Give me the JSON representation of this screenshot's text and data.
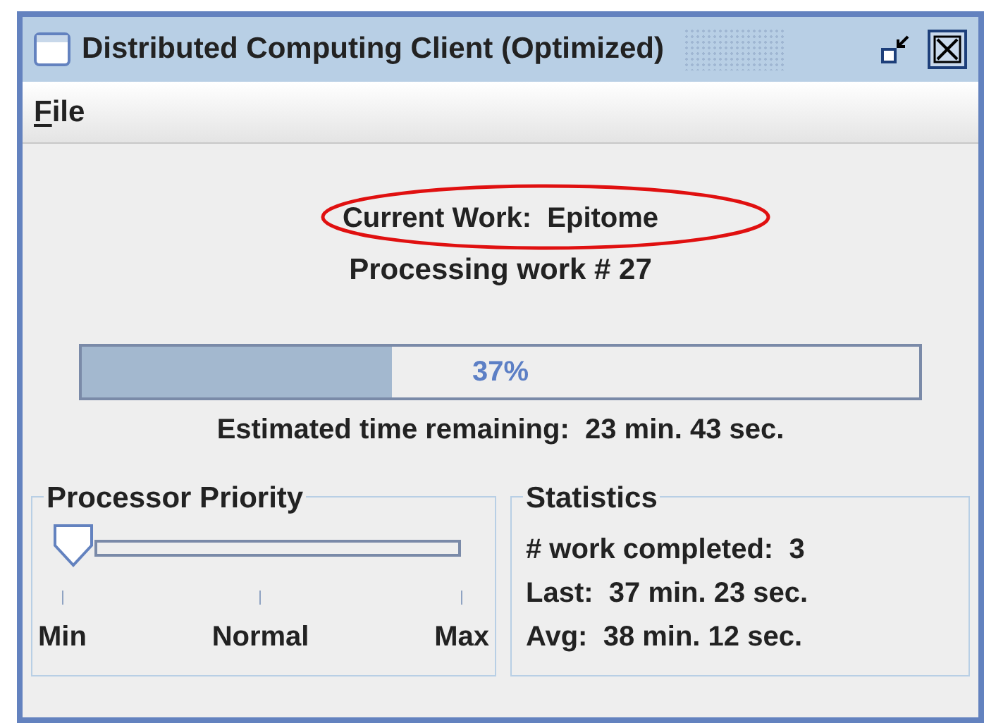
{
  "window": {
    "title": "Distributed Computing Client (Optimized)"
  },
  "menu": [
    {
      "label": "File"
    }
  ],
  "current_work": {
    "label": "Current Work:  Epitome",
    "highlighted": true
  },
  "processing": "Processing work # 27",
  "progress": {
    "level": 0.37,
    "reading": "37%"
  },
  "estimate": "Estimated time remaining:  23 min. 43 sec.",
  "priority": {
    "title": "Processor Priority",
    "level": 0,
    "ticks": [
      "Min",
      "Normal",
      "Max"
    ]
  },
  "statistics": {
    "title": "Statistics",
    "lines": [
      "# work completed:  3",
      "Last:  37 min. 23 sec.",
      "Avg:  38 min. 12 sec."
    ]
  }
}
